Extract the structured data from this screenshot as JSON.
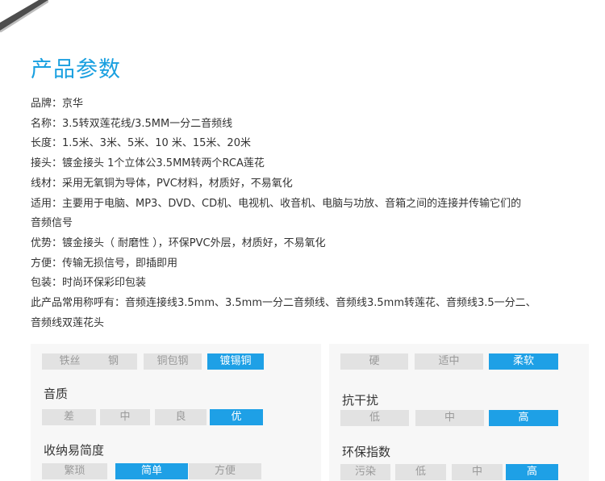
{
  "section_title": "产品参数",
  "specs": [
    "品牌：京华",
    "名称：3.5转双莲花线/3.5MM一分二音频线",
    "长度：1.5米、3米、5米、10 米、15米、20米",
    "接头：镀金接头 1个立体公3.5MM转两个RCA莲花",
    "线材：采用无氧铜为导体，PVC材料，材质好，不易氧化",
    "适用：主要用于电脑、MP3、DVD、CD机、电视机、收音机、电脑与功放、音箱之间的连接并传输它们的",
    "音频信号",
    "优势：镀金接头（ 耐磨性 ），环保PVC外层，材质好，不易氧化",
    "方便：传输无损信号，即插即用",
    "包装：时尚环保彩印包装",
    "此产品常用称呼有：音频连接线3.5mm、3.5mm一分二音频线、音频线3.5mm转莲花、音频线3.5一分二、",
    "音频线双莲花头"
  ],
  "ratings": {
    "material": {
      "options": [
        "铁丝",
        "钢",
        "铜包钢",
        "镀锡铜"
      ],
      "selected": "镀锡铜"
    },
    "sound": {
      "label": "音质",
      "options": [
        "差",
        "中",
        "良",
        "优"
      ],
      "selected": "优"
    },
    "storage": {
      "label": "收纳易简度",
      "options": [
        "繁琐",
        "简单",
        "方便"
      ],
      "selected": "简单"
    },
    "softness": {
      "options": [
        "硬",
        "适中",
        "柔软"
      ],
      "selected": "柔软"
    },
    "interference": {
      "label": "抗干扰",
      "options": [
        "低",
        "中",
        "高"
      ],
      "selected": "高"
    },
    "eco": {
      "label": "环保指数",
      "options": [
        "污染",
        "低",
        "中",
        "高"
      ],
      "selected": "高"
    }
  },
  "colors": {
    "title": "#1aa0e0",
    "active_segment": "#1ea0e6",
    "inactive_segment": "#e2e2e2",
    "panel_background": "#f7f7f7"
  }
}
